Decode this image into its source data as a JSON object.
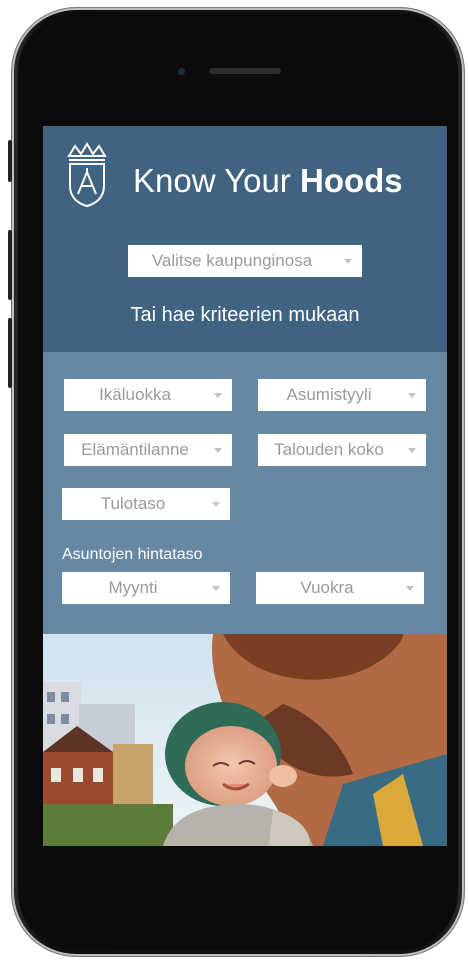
{
  "app": {
    "brand_prefix": "Know Your",
    "brand_bold": "Hoods"
  },
  "neighborhood_select": {
    "value": "Valitse kaupunginosa"
  },
  "subtitle": "Tai hae kriteerien mukaan",
  "filters": {
    "age_group": "Ikäluokka",
    "housing_style": "Asumistyyli",
    "life_situation": "Elämäntilanne",
    "household_size": "Talouden koko",
    "income_level": "Tulotaso"
  },
  "price_level": {
    "label": "Asuntojen hintataso",
    "sale": "Myynti",
    "rent": "Vuokra"
  },
  "colors": {
    "header_bg": "#3f6380",
    "filters_bg": "#6688a3",
    "select_text": "#9a9a9a"
  },
  "icons": [
    "city-crest-icon",
    "dropdown-arrow-icon"
  ]
}
